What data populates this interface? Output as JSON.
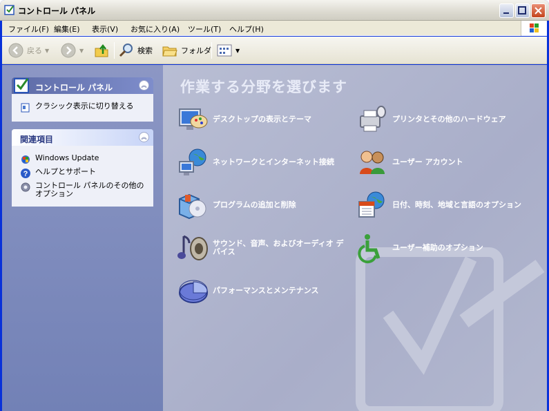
{
  "window": {
    "title": "コントロール パネル"
  },
  "menu": [
    "ファイル(F)",
    "編集(E)",
    "表示(V)",
    "お気に入り(A)",
    "ツール(T)",
    "ヘルプ(H)"
  ],
  "toolbar": {
    "back": "戻る",
    "search": "検索",
    "folders": "フォルダ"
  },
  "sidebar": {
    "control_panel": {
      "title": "コントロール パネル",
      "items": [
        {
          "label": "クラシック表示に切り替える"
        }
      ]
    },
    "related": {
      "title": "関連項目",
      "items": [
        {
          "label": "Windows Update"
        },
        {
          "label": "ヘルプとサポート"
        },
        {
          "label": "コントロール パネルのその他のオプション"
        }
      ]
    }
  },
  "main": {
    "heading": "作業する分野を選びます",
    "categories": [
      {
        "label": "デスクトップの表示とテーマ",
        "icon": "display-theme-icon"
      },
      {
        "label": "プリンタとその他のハードウェア",
        "icon": "printer-icon"
      },
      {
        "label": "ネットワークとインターネット接続",
        "icon": "network-icon"
      },
      {
        "label": "ユーザー アカウント",
        "icon": "users-icon"
      },
      {
        "label": "プログラムの追加と削除",
        "icon": "add-remove-programs-icon"
      },
      {
        "label": "日付、時刻、地域と言語のオプション",
        "icon": "date-time-region-icon"
      },
      {
        "label": "サウンド、音声、およびオーディオ デバイス",
        "icon": "sound-icon"
      },
      {
        "label": "ユーザー補助のオプション",
        "icon": "accessibility-icon"
      },
      {
        "label": "パフォーマンスとメンテナンス",
        "icon": "performance-icon"
      }
    ]
  },
  "colors": {
    "sidebar": "#7a87bd",
    "content": "#b0b5cd",
    "titlebar": "#dcdad0",
    "link_text": "#ffffff"
  }
}
